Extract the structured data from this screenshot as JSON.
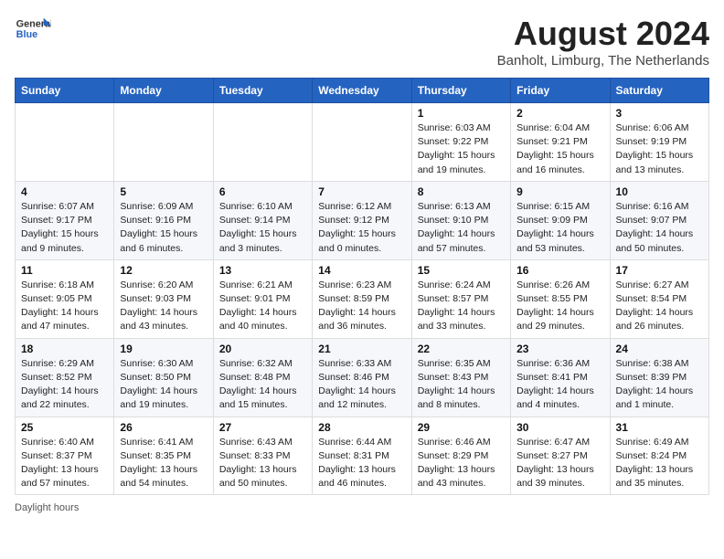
{
  "header": {
    "logo_general": "General",
    "logo_blue": "Blue",
    "month_year": "August 2024",
    "location": "Banholt, Limburg, The Netherlands"
  },
  "columns": [
    "Sunday",
    "Monday",
    "Tuesday",
    "Wednesday",
    "Thursday",
    "Friday",
    "Saturday"
  ],
  "weeks": [
    [
      {
        "day": "",
        "sunrise": "",
        "sunset": "",
        "daylight": ""
      },
      {
        "day": "",
        "sunrise": "",
        "sunset": "",
        "daylight": ""
      },
      {
        "day": "",
        "sunrise": "",
        "sunset": "",
        "daylight": ""
      },
      {
        "day": "",
        "sunrise": "",
        "sunset": "",
        "daylight": ""
      },
      {
        "day": "1",
        "sunrise": "Sunrise: 6:03 AM",
        "sunset": "Sunset: 9:22 PM",
        "daylight": "Daylight: 15 hours and 19 minutes."
      },
      {
        "day": "2",
        "sunrise": "Sunrise: 6:04 AM",
        "sunset": "Sunset: 9:21 PM",
        "daylight": "Daylight: 15 hours and 16 minutes."
      },
      {
        "day": "3",
        "sunrise": "Sunrise: 6:06 AM",
        "sunset": "Sunset: 9:19 PM",
        "daylight": "Daylight: 15 hours and 13 minutes."
      }
    ],
    [
      {
        "day": "4",
        "sunrise": "Sunrise: 6:07 AM",
        "sunset": "Sunset: 9:17 PM",
        "daylight": "Daylight: 15 hours and 9 minutes."
      },
      {
        "day": "5",
        "sunrise": "Sunrise: 6:09 AM",
        "sunset": "Sunset: 9:16 PM",
        "daylight": "Daylight: 15 hours and 6 minutes."
      },
      {
        "day": "6",
        "sunrise": "Sunrise: 6:10 AM",
        "sunset": "Sunset: 9:14 PM",
        "daylight": "Daylight: 15 hours and 3 minutes."
      },
      {
        "day": "7",
        "sunrise": "Sunrise: 6:12 AM",
        "sunset": "Sunset: 9:12 PM",
        "daylight": "Daylight: 15 hours and 0 minutes."
      },
      {
        "day": "8",
        "sunrise": "Sunrise: 6:13 AM",
        "sunset": "Sunset: 9:10 PM",
        "daylight": "Daylight: 14 hours and 57 minutes."
      },
      {
        "day": "9",
        "sunrise": "Sunrise: 6:15 AM",
        "sunset": "Sunset: 9:09 PM",
        "daylight": "Daylight: 14 hours and 53 minutes."
      },
      {
        "day": "10",
        "sunrise": "Sunrise: 6:16 AM",
        "sunset": "Sunset: 9:07 PM",
        "daylight": "Daylight: 14 hours and 50 minutes."
      }
    ],
    [
      {
        "day": "11",
        "sunrise": "Sunrise: 6:18 AM",
        "sunset": "Sunset: 9:05 PM",
        "daylight": "Daylight: 14 hours and 47 minutes."
      },
      {
        "day": "12",
        "sunrise": "Sunrise: 6:20 AM",
        "sunset": "Sunset: 9:03 PM",
        "daylight": "Daylight: 14 hours and 43 minutes."
      },
      {
        "day": "13",
        "sunrise": "Sunrise: 6:21 AM",
        "sunset": "Sunset: 9:01 PM",
        "daylight": "Daylight: 14 hours and 40 minutes."
      },
      {
        "day": "14",
        "sunrise": "Sunrise: 6:23 AM",
        "sunset": "Sunset: 8:59 PM",
        "daylight": "Daylight: 14 hours and 36 minutes."
      },
      {
        "day": "15",
        "sunrise": "Sunrise: 6:24 AM",
        "sunset": "Sunset: 8:57 PM",
        "daylight": "Daylight: 14 hours and 33 minutes."
      },
      {
        "day": "16",
        "sunrise": "Sunrise: 6:26 AM",
        "sunset": "Sunset: 8:55 PM",
        "daylight": "Daylight: 14 hours and 29 minutes."
      },
      {
        "day": "17",
        "sunrise": "Sunrise: 6:27 AM",
        "sunset": "Sunset: 8:54 PM",
        "daylight": "Daylight: 14 hours and 26 minutes."
      }
    ],
    [
      {
        "day": "18",
        "sunrise": "Sunrise: 6:29 AM",
        "sunset": "Sunset: 8:52 PM",
        "daylight": "Daylight: 14 hours and 22 minutes."
      },
      {
        "day": "19",
        "sunrise": "Sunrise: 6:30 AM",
        "sunset": "Sunset: 8:50 PM",
        "daylight": "Daylight: 14 hours and 19 minutes."
      },
      {
        "day": "20",
        "sunrise": "Sunrise: 6:32 AM",
        "sunset": "Sunset: 8:48 PM",
        "daylight": "Daylight: 14 hours and 15 minutes."
      },
      {
        "day": "21",
        "sunrise": "Sunrise: 6:33 AM",
        "sunset": "Sunset: 8:46 PM",
        "daylight": "Daylight: 14 hours and 12 minutes."
      },
      {
        "day": "22",
        "sunrise": "Sunrise: 6:35 AM",
        "sunset": "Sunset: 8:43 PM",
        "daylight": "Daylight: 14 hours and 8 minutes."
      },
      {
        "day": "23",
        "sunrise": "Sunrise: 6:36 AM",
        "sunset": "Sunset: 8:41 PM",
        "daylight": "Daylight: 14 hours and 4 minutes."
      },
      {
        "day": "24",
        "sunrise": "Sunrise: 6:38 AM",
        "sunset": "Sunset: 8:39 PM",
        "daylight": "Daylight: 14 hours and 1 minute."
      }
    ],
    [
      {
        "day": "25",
        "sunrise": "Sunrise: 6:40 AM",
        "sunset": "Sunset: 8:37 PM",
        "daylight": "Daylight: 13 hours and 57 minutes."
      },
      {
        "day": "26",
        "sunrise": "Sunrise: 6:41 AM",
        "sunset": "Sunset: 8:35 PM",
        "daylight": "Daylight: 13 hours and 54 minutes."
      },
      {
        "day": "27",
        "sunrise": "Sunrise: 6:43 AM",
        "sunset": "Sunset: 8:33 PM",
        "daylight": "Daylight: 13 hours and 50 minutes."
      },
      {
        "day": "28",
        "sunrise": "Sunrise: 6:44 AM",
        "sunset": "Sunset: 8:31 PM",
        "daylight": "Daylight: 13 hours and 46 minutes."
      },
      {
        "day": "29",
        "sunrise": "Sunrise: 6:46 AM",
        "sunset": "Sunset: 8:29 PM",
        "daylight": "Daylight: 13 hours and 43 minutes."
      },
      {
        "day": "30",
        "sunrise": "Sunrise: 6:47 AM",
        "sunset": "Sunset: 8:27 PM",
        "daylight": "Daylight: 13 hours and 39 minutes."
      },
      {
        "day": "31",
        "sunrise": "Sunrise: 6:49 AM",
        "sunset": "Sunset: 8:24 PM",
        "daylight": "Daylight: 13 hours and 35 minutes."
      }
    ]
  ],
  "footer": {
    "daylight_note": "Daylight hours"
  }
}
